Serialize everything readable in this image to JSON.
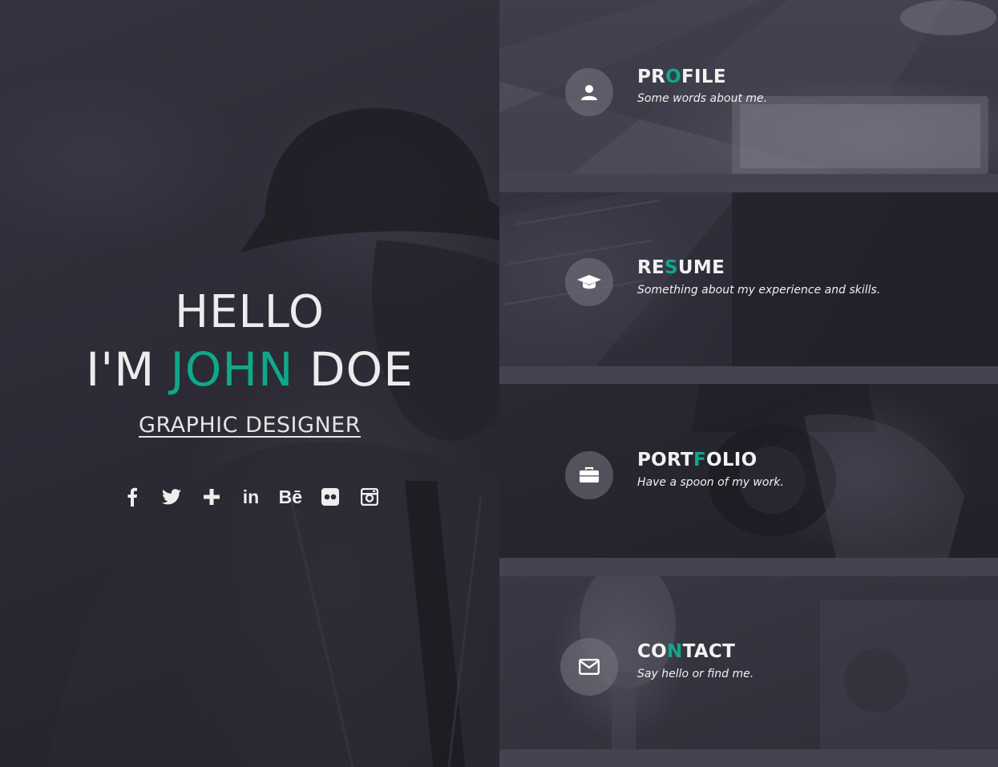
{
  "hero": {
    "greeting": "HELLO",
    "name_prefix": "I'M",
    "name_first": "JOHN",
    "name_last": "DOE",
    "role": "GRAPHIC DESIGNER",
    "social": [
      {
        "name": "facebook-icon"
      },
      {
        "name": "twitter-icon"
      },
      {
        "name": "google-plus-icon"
      },
      {
        "name": "linkedin-icon",
        "text": "in"
      },
      {
        "name": "behance-icon",
        "text": "Bē"
      },
      {
        "name": "flickr-icon"
      },
      {
        "name": "instagram-icon"
      }
    ]
  },
  "menu": [
    {
      "title_a": "PR",
      "title_hl": "O",
      "title_b": "FILE",
      "subtitle": "Some words about me.",
      "icon": "user-icon"
    },
    {
      "title_a": "RE",
      "title_hl": "S",
      "title_b": "UME",
      "subtitle": "Something about my experience and skills.",
      "icon": "graduation-cap-icon"
    },
    {
      "title_a": "PORT",
      "title_hl": "F",
      "title_b": "OLIO",
      "subtitle": "Have a spoon of my work.",
      "icon": "briefcase-icon"
    },
    {
      "title_a": "CO",
      "title_hl": "N",
      "title_b": "TACT",
      "subtitle": "Say hello or find me.",
      "icon": "envelope-icon"
    }
  ],
  "colors": {
    "accent": "#10a88a",
    "background": "#45434f",
    "text": "#f2f2f2"
  }
}
